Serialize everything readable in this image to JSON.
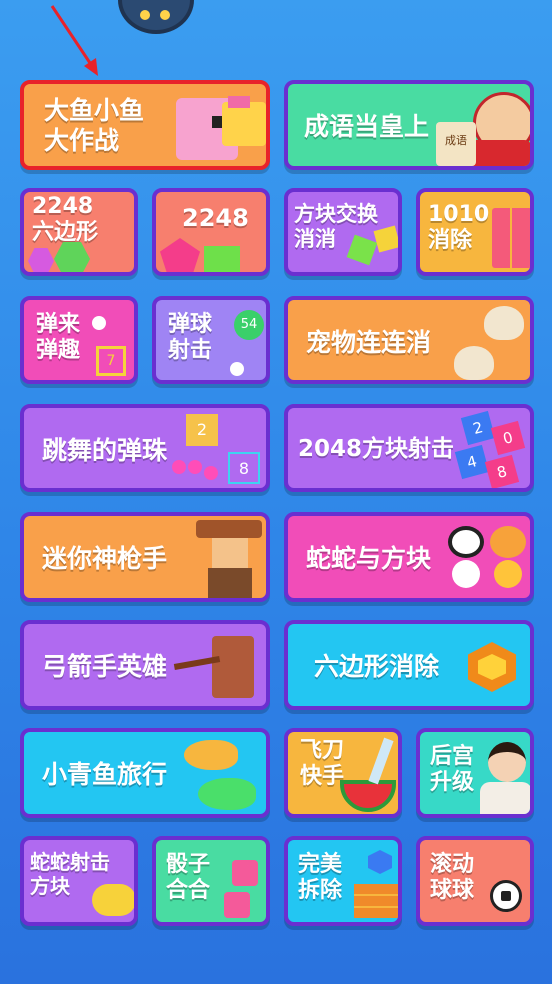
{
  "games": [
    {
      "name": "大鱼小鱼\n大作战"
    },
    {
      "name": "成语当皇上"
    },
    {
      "name": "2248\n六边形"
    },
    {
      "name": "2248"
    },
    {
      "name": "方块交换\n消消"
    },
    {
      "name": "1010\n消除"
    },
    {
      "name": "弹来\n弹趣"
    },
    {
      "name": "弹球\n射击"
    },
    {
      "name": "宠物连连消"
    },
    {
      "name": "跳舞的弹珠"
    },
    {
      "name": "2048方块射击"
    },
    {
      "name": "迷你神枪手"
    },
    {
      "name": "蛇蛇与方块"
    },
    {
      "name": "弓箭手英雄"
    },
    {
      "name": "六边形消除"
    },
    {
      "name": "小青鱼旅行"
    },
    {
      "name": "飞刀\n快手"
    },
    {
      "name": "后宫\n升级"
    },
    {
      "name": "蛇蛇射击\n方块"
    },
    {
      "name": "骰子\n合合"
    },
    {
      "name": "完美\n拆除"
    },
    {
      "name": "滚动\n球球"
    }
  ],
  "decor": {
    "idiom_scroll": "成语",
    "ball_count": "54",
    "dance_numbers": [
      "2",
      "8"
    ],
    "block_numbers": [
      "2",
      "0",
      "4",
      "8"
    ],
    "die_number": "7"
  },
  "colors": {
    "background": "#3b9df0",
    "tile_border": "#6a2fd0",
    "selected_border": "#e8222a",
    "arrow": "#e8222a"
  }
}
